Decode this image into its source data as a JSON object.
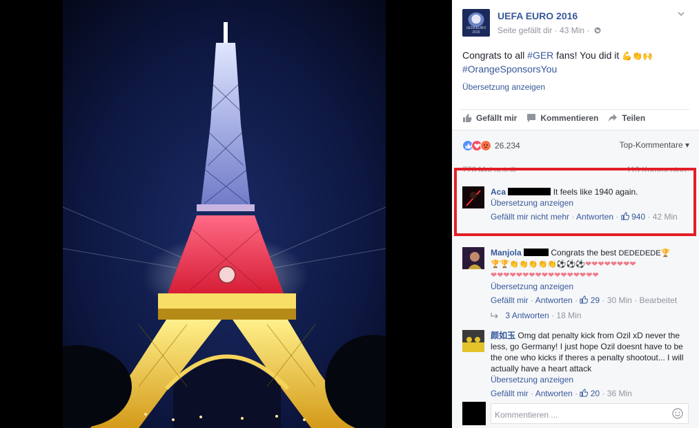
{
  "post": {
    "page_name": "UEFA EURO 2016",
    "logo_text": "UEFA EURO 2016",
    "meta": "Seite gefällt dir · 43 Min ·",
    "text_prefix": "Congrats to all ",
    "hashtag1": "#GER",
    "text_suffix": " fans! You did it ",
    "hashtag2": "#OrangeSponsorsYou",
    "emojis": "💪👏🙌",
    "translate": "Übersetzung anzeigen"
  },
  "actions": {
    "like": "Gefällt mir",
    "comment": "Kommentieren",
    "share": "Teilen"
  },
  "stats": {
    "reactions_count": "26.234",
    "sort_label": "Top-Kommentare ▾",
    "shares": "776 Mal geteilt",
    "comments": "113 Kommentare"
  },
  "comments": [
    {
      "author": "Aca",
      "text": "It feels like 1940 again.",
      "translate": "Übersetzung anzeigen",
      "like_label": "Gefällt mir nicht mehr",
      "reply_label": "Antworten",
      "likes": "940",
      "time": "42 Min"
    },
    {
      "author": "Manjola",
      "text": "Congrats the best",
      "emoji_line1": "DEDEDEDE🏆",
      "emoji_line2": "🏆🏆👏👏👏👏👏⚽⚽⚽❤❤❤❤❤❤❤❤",
      "emoji_line3": "❤❤❤❤❤❤❤❤❤❤❤❤❤❤❤❤❤",
      "translate": "Übersetzung anzeigen",
      "like_label": "Gefällt mir",
      "reply_label": "Antworten",
      "likes": "29",
      "time": "30 Min",
      "edited": "Bearbeitet",
      "replies": "3 Antworten",
      "replies_time": "18 Min"
    },
    {
      "author": "颜如玉",
      "text": "Omg dat penalty kick from Ozil xD never the less, go Germany! I just hope Ozil doesnt have to be the one who kicks if theres a penalty shootout... I will actually have a heart attack",
      "translate": "Übersetzung anzeigen",
      "like_label": "Gefällt mir",
      "reply_label": "Antworten",
      "likes": "20",
      "time": "36 Min"
    }
  ],
  "compose": {
    "placeholder": "Kommentieren ..."
  },
  "colors": {
    "link": "#365899",
    "highlight": "#e41e26",
    "tower_black": "#1b1b26",
    "tower_red": "#e0263a",
    "tower_gold": "#f2c23a"
  }
}
